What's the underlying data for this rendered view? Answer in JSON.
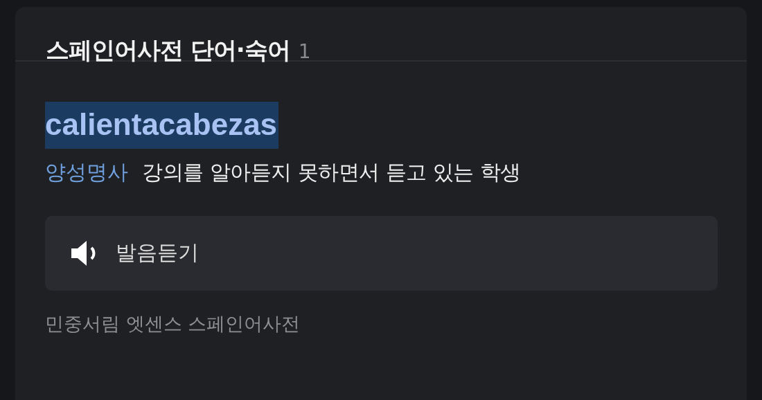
{
  "header": {
    "title": "스페인어사전 단어·숙어",
    "count": "1"
  },
  "entry": {
    "word": "calientacabezas",
    "highlighted": true,
    "part_of_speech": "양성명사",
    "definition": "강의를 알아듣지 못하면서 듣고 있는 학생"
  },
  "pronounce_button": {
    "label": "발음듣기"
  },
  "source": "민중서림 엣센스 스페인어사전"
}
